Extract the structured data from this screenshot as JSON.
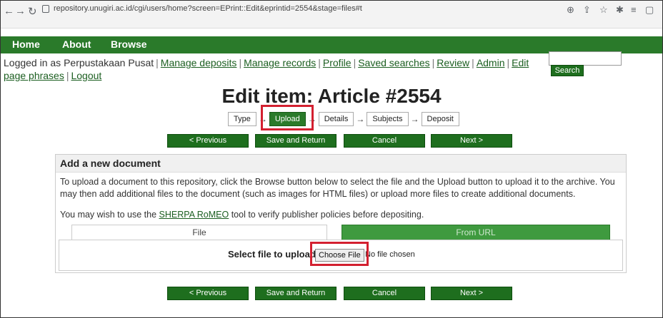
{
  "browser": {
    "url": "repository.unugiri.ac.id/cgi/users/home?screen=EPrint::Edit&eprintid=2554&stage=files#t",
    "icons": [
      "back-icon",
      "forward-icon",
      "reload-icon",
      "lock-icon",
      "zoom-icon",
      "share-icon",
      "star-icon",
      "extensions-icon",
      "reading-list-icon",
      "sidebar-icon"
    ]
  },
  "nav": {
    "home": "Home",
    "about": "About",
    "browse": "Browse"
  },
  "login": {
    "logged_in_text": "Logged in as Perpustakaan Pusat",
    "links": [
      "Manage deposits",
      "Manage records",
      "Profile",
      "Saved searches",
      "Review",
      "Admin",
      "Edit page phrases",
      "Logout"
    ]
  },
  "search": {
    "placeholder": "",
    "button": "Search"
  },
  "page": {
    "title": "Edit item: Article #2554"
  },
  "stages": [
    "Type",
    "Upload",
    "Details",
    "Subjects",
    "Deposit"
  ],
  "actions": {
    "previous": "< Previous",
    "save_return": "Save and Return",
    "cancel": "Cancel",
    "next": "Next >"
  },
  "panel": {
    "title": "Add a new document",
    "para1": "To upload a document to this repository, click the Browse button below to select the file and the Upload button to upload it to the archive. You may then add additional files to the document (such as images for HTML files) or upload more files to create additional documents.",
    "para2_before": "You may wish to use the ",
    "para2_link": "SHERPA RoMEO",
    "para2_after": " tool to verify publisher policies before depositing.",
    "tab_file": "File",
    "tab_url": "From URL",
    "select_label": "Select file to upload",
    "choose_button": "Choose File",
    "no_file": "No file chosen"
  },
  "colors": {
    "nav_green": "#2a7a2a",
    "button_green": "#1e6e1e",
    "highlight_red": "#d32030"
  }
}
